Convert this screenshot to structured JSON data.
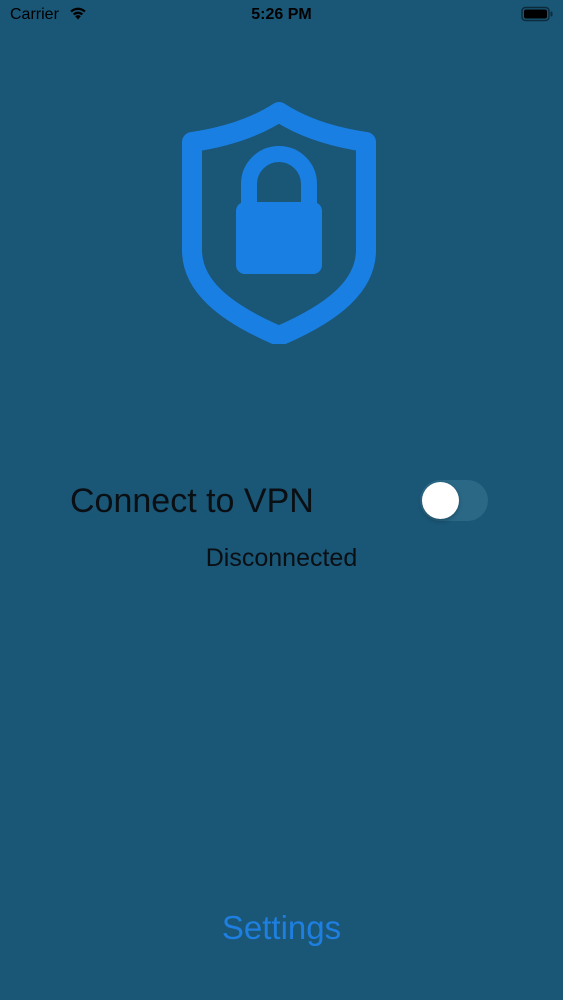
{
  "status_bar": {
    "carrier": "Carrier",
    "time": "5:26 PM",
    "wifi_icon": "wifi-icon",
    "battery_icon": "battery-icon"
  },
  "hero": {
    "icon": "shield-lock-icon",
    "icon_color": "#1a7fe3"
  },
  "vpn": {
    "label": "Connect to VPN",
    "toggle_on": false,
    "status": "Disconnected"
  },
  "footer": {
    "settings_label": "Settings",
    "accent_color": "#1e7fe0"
  },
  "colors": {
    "background": "#1a5676",
    "text": "#0a0f14"
  }
}
